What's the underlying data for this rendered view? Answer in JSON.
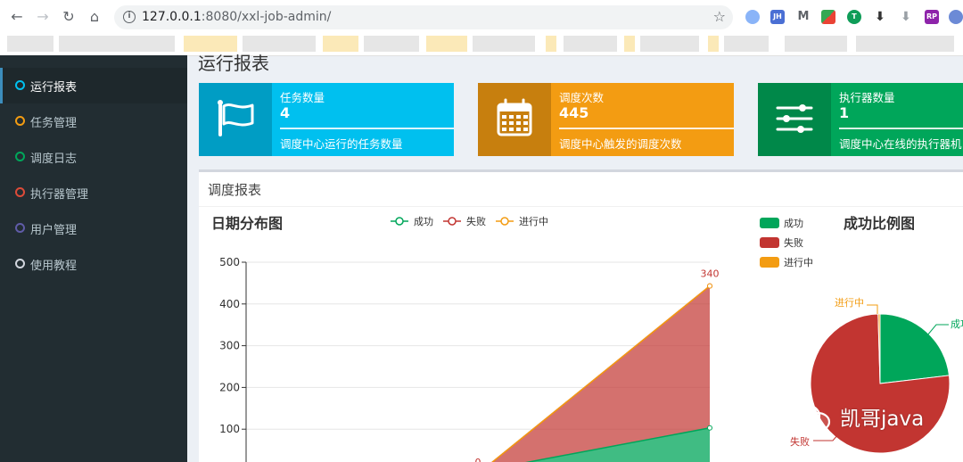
{
  "browser": {
    "url_host": "127.0.0.1",
    "url_rest": ":8080/xxl-job-admin/",
    "ext_jh": "JH",
    "ext_rp": "RP"
  },
  "sidebar": {
    "items": [
      {
        "label": "运行报表",
        "color": "#00c0ef",
        "active": true
      },
      {
        "label": "任务管理",
        "color": "#f39c12"
      },
      {
        "label": "调度日志",
        "color": "#00a65a"
      },
      {
        "label": "执行器管理",
        "color": "#dd4b39"
      },
      {
        "label": "用户管理",
        "color": "#605ca8"
      },
      {
        "label": "使用教程",
        "color": "#d2d6de"
      }
    ]
  },
  "page": {
    "title": "运行报表"
  },
  "info_boxes": [
    {
      "label": "任务数量",
      "value": "4",
      "desc": "调度中心运行的任务数量",
      "color": "#00c0ef",
      "icon": "flag-icon"
    },
    {
      "label": "调度次数",
      "value": "445",
      "desc": "调度中心触发的调度次数",
      "color": "#f39c12",
      "icon": "calendar-icon"
    },
    {
      "label": "执行器数量",
      "value": "1",
      "desc": "调度中心在线的执行器机",
      "color": "#00a65a",
      "icon": "sliders-icon"
    }
  ],
  "panel": {
    "title": "调度报表"
  },
  "chart_data": [
    {
      "type": "area",
      "title": "日期分布图",
      "series": [
        {
          "name": "成功",
          "color": "#00a65a",
          "values": [
            0,
            0,
            103
          ]
        },
        {
          "name": "失败",
          "color": "#c23531",
          "values": [
            0,
            0,
            340
          ]
        },
        {
          "name": "进行中",
          "color": "#f39c12",
          "values": [
            0,
            0,
            0
          ]
        }
      ],
      "stacked": true,
      "ylim": [
        0,
        500
      ],
      "yticks": [
        100,
        200,
        300,
        400,
        500
      ],
      "data_labels": [
        "0",
        "340"
      ],
      "grid": true,
      "legend": "top"
    },
    {
      "type": "pie",
      "title": "成功比例图",
      "slices": [
        {
          "name": "成功",
          "value": 103,
          "color": "#00a65a"
        },
        {
          "name": "失败",
          "value": 340,
          "color": "#c23531"
        },
        {
          "name": "进行中",
          "value": 2,
          "color": "#f39c12"
        }
      ],
      "outer_labels": [
        "进行中",
        "成功",
        "失败"
      ],
      "legend": "top-left"
    }
  ],
  "watermark": {
    "text": "凯哥java"
  }
}
